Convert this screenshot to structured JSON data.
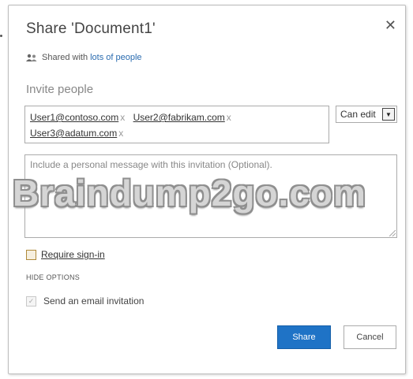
{
  "dialog": {
    "title": "Share 'Document1'",
    "close_glyph": "✕"
  },
  "shared": {
    "prefix": "Shared with",
    "link": "lots of people",
    "icon": "people-icon"
  },
  "invite": {
    "label": "Invite people",
    "recipients": [
      {
        "email": "User1@contoso.com",
        "remove": "x"
      },
      {
        "email": "User2@fabrikam.com",
        "remove": "x"
      },
      {
        "email": "User3@adatum.com",
        "remove": "x"
      }
    ]
  },
  "permission": {
    "selected": "Can edit",
    "arrow": "▼"
  },
  "message": {
    "placeholder": "Include a personal message with this invitation (Optional)."
  },
  "watermark": "Braindump2go.com",
  "options": {
    "require_signin_label": "Require sign-in",
    "require_signin_checked": false,
    "hide_options_label": "HIDE OPTIONS",
    "send_email_label": "Send an email invitation",
    "send_email_checked": true,
    "check_glyph": "✓"
  },
  "buttons": {
    "share": "Share",
    "cancel": "Cancel"
  },
  "colors": {
    "primary": "#1f73c6",
    "link": "#2b6cb0",
    "checkbox_border": "#b08a3a"
  }
}
